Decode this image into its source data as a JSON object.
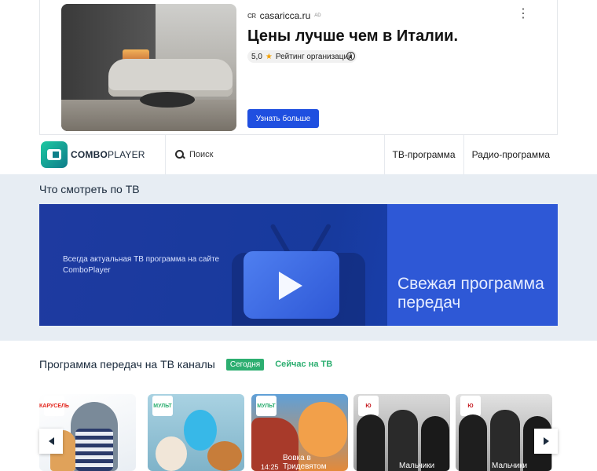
{
  "ad": {
    "domain": "casaricca.ru",
    "domain_mark": "AD",
    "logo_text": "CR",
    "title": "Цены лучше чем в Италии.",
    "rating_value": "5,0",
    "rating_label": "Рейтинг организации",
    "button_label": "Узнать больше",
    "menu_glyph": "⋮",
    "info_glyph": "i"
  },
  "header": {
    "brand_bold": "COMBO",
    "brand_rest": "PLAYER",
    "search_placeholder": "Поиск",
    "nav": [
      "ТВ-программа",
      "Радио-программа"
    ]
  },
  "hero": {
    "title": "Что смотреть по ТВ",
    "subtitle": "Всегда актуальная ТВ программа на сайте ComboPlayer",
    "headline": "Свежая программа передач"
  },
  "channels": {
    "title": "Программа передач на ТВ каналы",
    "today": "Сегодня",
    "now": "Сейчас на ТВ",
    "cards": [
      {
        "badge": "КАРУСЕЛЬ",
        "time": "",
        "show": "",
        "color": "#ffffff"
      },
      {
        "badge": "МУЛЬТ",
        "time": "",
        "show": "",
        "color": "#9cc4d8"
      },
      {
        "badge": "МУЛЬТ",
        "time": "14:25",
        "show": "Вовка в Тридевятом",
        "color": "#3e6fa8"
      },
      {
        "badge": "Ю",
        "time": "",
        "show": "Мальчики",
        "color": "#4a4a4a"
      },
      {
        "badge": "Ю",
        "time": "",
        "show": "Мальчики",
        "color": "#5a5a5a"
      },
      {
        "badge": "",
        "time": "",
        "show": "",
        "color": "#6a6a6a"
      }
    ]
  },
  "colors": {
    "accent_green": "#2cae70",
    "brand_blue": "#1f4fe0",
    "banner": "#1e3aa0"
  }
}
